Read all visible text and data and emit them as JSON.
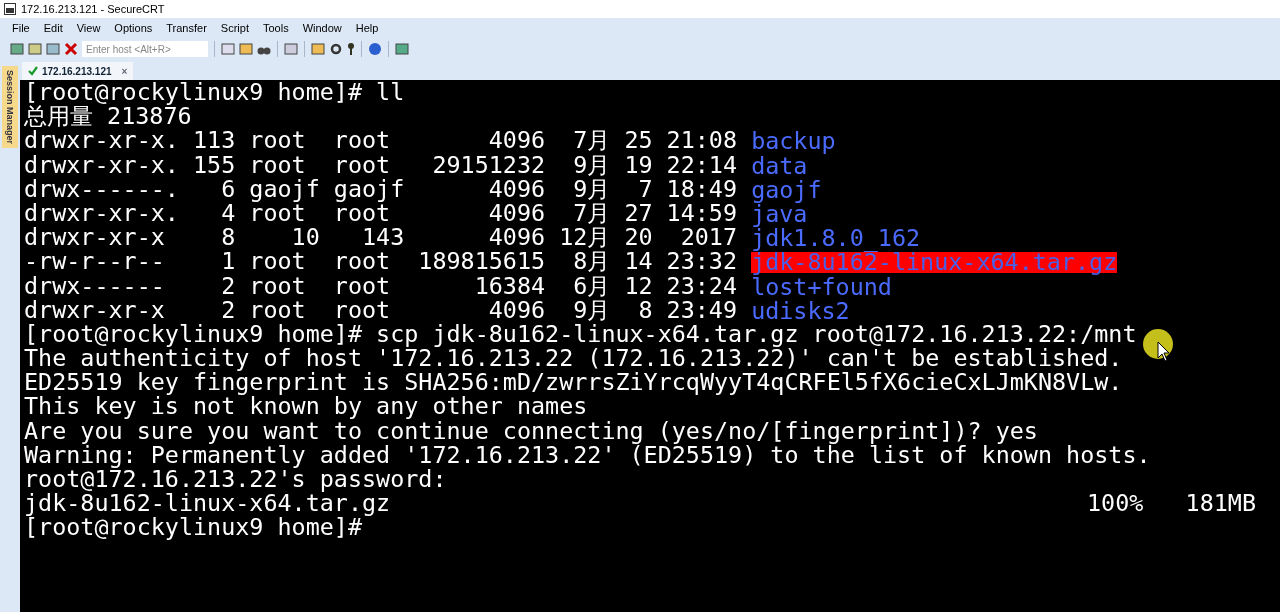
{
  "window": {
    "title": "172.16.213.121 - SecureCRT"
  },
  "menu": [
    "File",
    "Edit",
    "View",
    "Options",
    "Transfer",
    "Script",
    "Tools",
    "Window",
    "Help"
  ],
  "toolbar": {
    "host_placeholder": "Enter host <Alt+R>"
  },
  "side_panel": {
    "label": "Session Manager"
  },
  "tabs": [
    {
      "label": "172.16.213.121",
      "connected": true,
      "selected": true,
      "close": "×"
    }
  ],
  "terminal": {
    "lines": [
      {
        "kind": "text",
        "text": "[root@rockylinux9 home]# ll"
      },
      {
        "kind": "text",
        "text": "总用量 213876"
      },
      {
        "kind": "entry",
        "info": "drwxr-xr-x. 113 root  root       4096  7月 25 21:08 ",
        "name": "backup",
        "highlighted": false
      },
      {
        "kind": "entry",
        "info": "drwxr-xr-x. 155 root  root   29151232  9月 19 22:14 ",
        "name": "data",
        "highlighted": false
      },
      {
        "kind": "entry",
        "info": "drwx------.   6 gaojf gaojf      4096  9月  7 18:49 ",
        "name": "gaojf",
        "highlighted": false
      },
      {
        "kind": "entry",
        "info": "drwxr-xr-x.   4 root  root       4096  7月 27 14:59 ",
        "name": "java",
        "highlighted": false
      },
      {
        "kind": "entry",
        "info": "drwxr-xr-x    8    10   143      4096 12月 20  2017 ",
        "name": "jdk1.8.0_162",
        "highlighted": false
      },
      {
        "kind": "entry",
        "info": "-rw-r--r--    1 root  root  189815615  8月 14 23:32 ",
        "name": "jdk-8u162-linux-x64.tar.gz",
        "highlighted": true
      },
      {
        "kind": "entry",
        "info": "drwx------    2 root  root      16384  6月 12 23:24 ",
        "name": "lost+found",
        "highlighted": false
      },
      {
        "kind": "entry",
        "info": "drwxr-xr-x    2 root  root       4096  9月  8 23:49 ",
        "name": "udisks2",
        "highlighted": false
      },
      {
        "kind": "text",
        "text": "[root@rockylinux9 home]# scp jdk-8u162-linux-x64.tar.gz root@172.16.213.22:/mnt"
      },
      {
        "kind": "text",
        "text": "The authenticity of host '172.16.213.22 (172.16.213.22)' can't be established."
      },
      {
        "kind": "text",
        "text": "ED25519 key fingerprint is SHA256:mD/zwrrsZiYrcqWyyT4qCRFEl5fX6cieCxLJmKN8VLw."
      },
      {
        "kind": "text",
        "text": "This key is not known by any other names"
      },
      {
        "kind": "text",
        "text": "Are you sure you want to continue connecting (yes/no/[fingerprint])? yes"
      },
      {
        "kind": "text",
        "text": "Warning: Permanently added '172.16.213.22' (ED25519) to the list of known hosts."
      },
      {
        "kind": "text",
        "text": "root@172.16.213.22's password:"
      },
      {
        "kind": "progress",
        "file": "jdk-8u162-linux-x64.tar.gz",
        "progress": "100%   181MB"
      },
      {
        "kind": "text",
        "text": "[root@rockylinux9 home]#"
      }
    ]
  }
}
